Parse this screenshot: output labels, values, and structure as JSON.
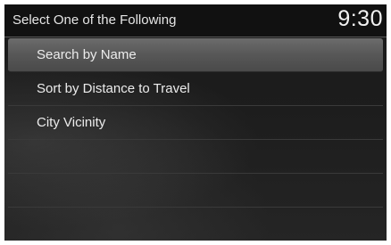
{
  "header": {
    "title": "Select One of the Following",
    "clock": "9:30"
  },
  "menu": {
    "items": [
      {
        "label": "Search by Name",
        "selected": true
      },
      {
        "label": "Sort by Distance to Travel",
        "selected": false
      },
      {
        "label": "City Vicinity",
        "selected": false
      }
    ],
    "empty_rows": 3
  }
}
